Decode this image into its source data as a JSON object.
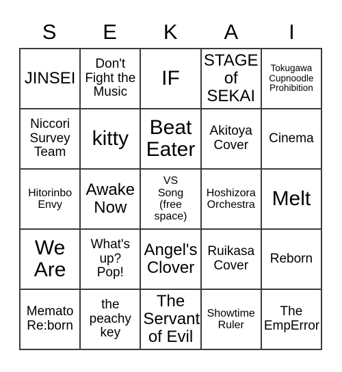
{
  "card": {
    "header_letters": [
      "S",
      "E",
      "K",
      "A",
      "I"
    ],
    "rows": [
      [
        {
          "text": "JINSEI",
          "size": "lg"
        },
        {
          "text": "Don't\nFight the\nMusic",
          "size": "md"
        },
        {
          "text": "IF",
          "size": "xl"
        },
        {
          "text": "STAGE\nof\nSEKAI",
          "size": "lg"
        },
        {
          "text": "Tokugawa\nCupnoodle\nProhibition",
          "size": "xs"
        }
      ],
      [
        {
          "text": "Niccori\nSurvey\nTeam",
          "size": "md"
        },
        {
          "text": "kitty",
          "size": "xl"
        },
        {
          "text": "Beat\nEater",
          "size": "xl"
        },
        {
          "text": "Akitoya\nCover",
          "size": "md"
        },
        {
          "text": "Cinema",
          "size": "md"
        }
      ],
      [
        {
          "text": "Hitorinbo\nEnvy",
          "size": "sm"
        },
        {
          "text": "Awake\nNow",
          "size": "lg"
        },
        {
          "text": "VS\nSong\n(free\nspace)",
          "size": "sm"
        },
        {
          "text": "Hoshizora\nOrchestra",
          "size": "sm"
        },
        {
          "text": "Melt",
          "size": "xl"
        }
      ],
      [
        {
          "text": "We\nAre",
          "size": "xl"
        },
        {
          "text": "What's\nup?\nPop!",
          "size": "md"
        },
        {
          "text": "Angel's\nClover",
          "size": "lg"
        },
        {
          "text": "Ruikasa\nCover",
          "size": "md"
        },
        {
          "text": "Reborn",
          "size": "md"
        }
      ],
      [
        {
          "text": "Memato\nRe:born",
          "size": "md"
        },
        {
          "text": "the\npeachy\nkey",
          "size": "md"
        },
        {
          "text": "The\nServant\nof Evil",
          "size": "lg"
        },
        {
          "text": "Showtime\nRuler",
          "size": "sm"
        },
        {
          "text": "The\nEmpError",
          "size": "md"
        }
      ]
    ],
    "free_space": {
      "row": 2,
      "col": 2,
      "label": "VS Song (free space)"
    },
    "colors": {
      "border": "#3a3a3a",
      "text": "#000000",
      "background": "#ffffff"
    }
  }
}
